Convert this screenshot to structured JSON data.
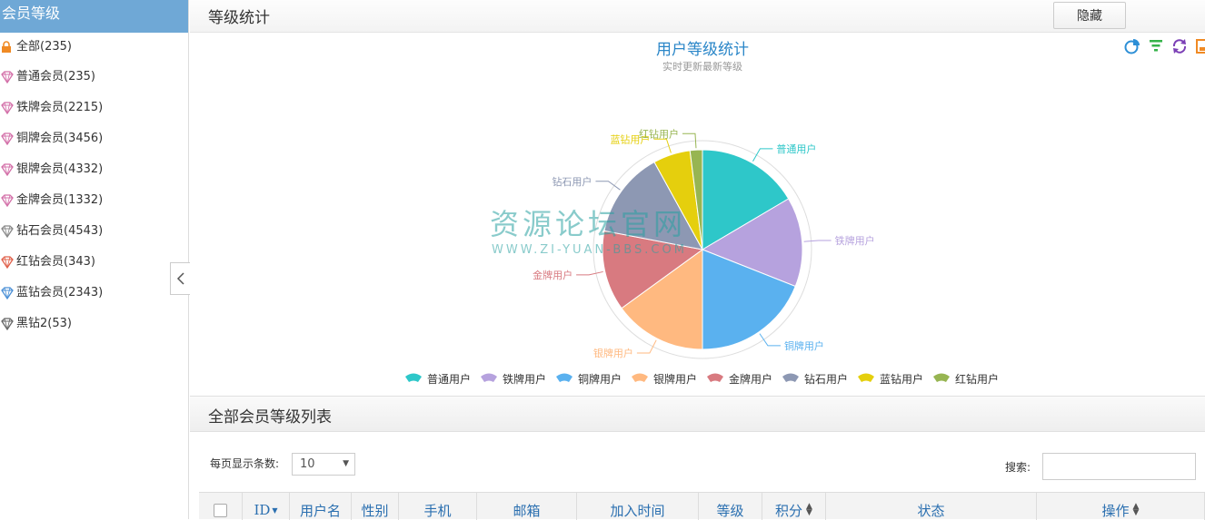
{
  "sidebar": {
    "title": "会员等级",
    "items": [
      {
        "label": "全部(235)",
        "icon": "lock-icon",
        "color": "#f08a24"
      },
      {
        "label": "普通会员(235)",
        "icon": "diamond-icon",
        "color": "#d36fa8"
      },
      {
        "label": "铁牌会员(2215)",
        "icon": "diamond-icon",
        "color": "#d36fa8"
      },
      {
        "label": "铜牌会员(3456)",
        "icon": "diamond-icon",
        "color": "#d36fa8"
      },
      {
        "label": "银牌会员(4332)",
        "icon": "diamond-icon",
        "color": "#d36fa8"
      },
      {
        "label": "金牌会员(1332)",
        "icon": "diamond-icon",
        "color": "#d36fa8"
      },
      {
        "label": " 钻石会员(4543)",
        "icon": "diamond-icon",
        "color": "#888888"
      },
      {
        "label": "红钻会员(343)",
        "icon": "diamond-icon",
        "color": "#e0604a"
      },
      {
        "label": "蓝钻会员(2343)",
        "icon": "diamond-icon",
        "color": "#4a8fd6"
      },
      {
        "label": " 黑钻2(53)",
        "icon": "diamond-icon",
        "color": "#666666"
      }
    ]
  },
  "panel": {
    "title": "等级统计",
    "hide_label": "隐藏"
  },
  "toolbox": {
    "icons": [
      "pie-chart-icon",
      "funnel-icon",
      "refresh-icon",
      "save-icon"
    ]
  },
  "watermark": {
    "cn": "资源论坛官网",
    "en": "WWW.ZI-YUAN-BBS.COM"
  },
  "chart_data": {
    "type": "pie",
    "title": "用户等级统计",
    "subtitle": "实时更新最新等级",
    "legend_position": "bottom-center",
    "categories": [
      "普通用户",
      "铁牌用户",
      "铜牌用户",
      "银牌用户",
      "金牌用户",
      "钻石用户",
      "蓝钻用户",
      "红钻用户"
    ],
    "values": [
      16.5,
      14.5,
      19,
      15,
      13,
      14,
      6,
      2
    ],
    "colors": [
      "#2ec7c9",
      "#b6a2de",
      "#5ab1ef",
      "#ffb980",
      "#d87a80",
      "#8d98b3",
      "#e5cf0d",
      "#97b552"
    ]
  },
  "list": {
    "title": "全部会员等级列表",
    "length_label": "每页显示条数:",
    "length_value": "10",
    "search_label": "搜索:",
    "columns": [
      "ID",
      "用户名",
      "性别",
      "手机",
      "邮箱",
      "加入时间",
      "等级",
      "积分",
      "状态",
      "操作"
    ]
  }
}
